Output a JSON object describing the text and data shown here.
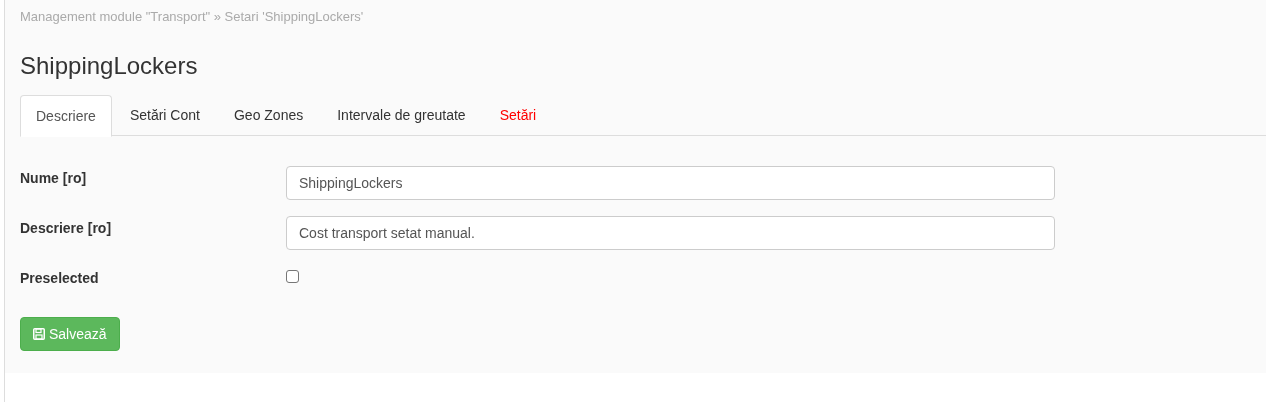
{
  "breadcrumb": "Management module \"Transport\" » Setari 'ShippingLockers'",
  "title": "ShippingLockers",
  "tabs": [
    {
      "label": "Descriere",
      "selected": true,
      "color": "#555555"
    },
    {
      "label": "Setări Cont",
      "selected": false,
      "color": "#333333"
    },
    {
      "label": "Geo Zones",
      "selected": false,
      "color": "#333333"
    },
    {
      "label": "Intervale de greutate",
      "selected": false,
      "color": "#333333"
    },
    {
      "label": "Setări",
      "selected": false,
      "color": "#ff0000"
    }
  ],
  "fields": [
    {
      "kind": "text",
      "label": "Nume [ro]",
      "value": "ShippingLockers"
    },
    {
      "kind": "text",
      "label": "Descriere [ro]",
      "value": "Cost transport setat manual."
    },
    {
      "kind": "checkbox",
      "label": "Preselected",
      "checked": false
    }
  ],
  "save_button": "Salvează"
}
